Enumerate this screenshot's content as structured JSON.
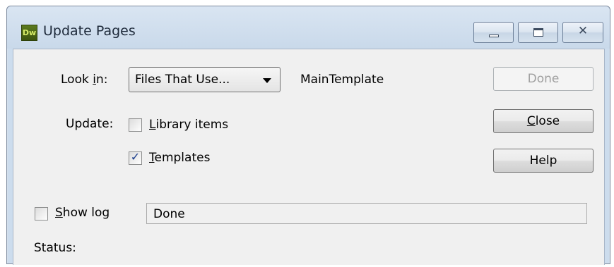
{
  "window": {
    "title": "Update Pages",
    "app_icon_label": "Dw",
    "caption_buttons": [
      "minimize-icon",
      "maximize-icon",
      "close-icon"
    ],
    "close_glyph": "✕"
  },
  "look_in": {
    "label_prefix": "Look ",
    "label_accel": "i",
    "label_suffix": "n:",
    "selected": "Files That Use...",
    "value_text": "MainTemplate"
  },
  "update": {
    "label": "Update:",
    "library_items": {
      "accel": "L",
      "rest": "ibrary items",
      "checked": false
    },
    "templates": {
      "accel": "T",
      "rest": "emplates",
      "checked": true,
      "check_glyph": "✓"
    }
  },
  "buttons": {
    "done": "Done",
    "close_accel": "C",
    "close_rest": "lose",
    "help": "Help"
  },
  "show_log": {
    "accel": "S",
    "rest": "how log",
    "checked": false
  },
  "status_field_value": "Done",
  "status_label": "Status:",
  "colors": {
    "icon_bg": "#4a6516",
    "icon_text": "#d7ec6a",
    "check_mark": "#1b3e8c",
    "disabled_text": "#a0a0a0"
  }
}
